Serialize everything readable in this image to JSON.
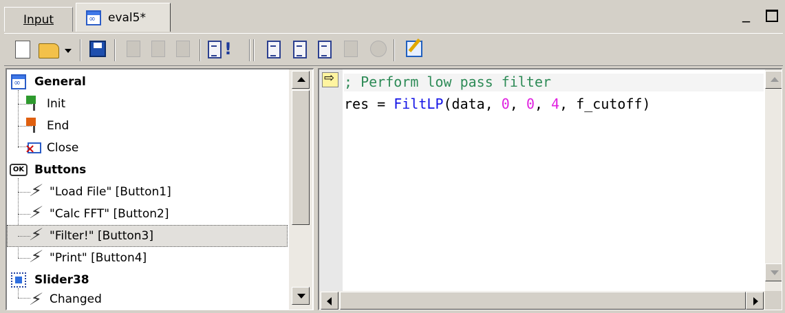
{
  "tabs": {
    "input": {
      "label": "Input"
    },
    "active": {
      "label": "eval5*"
    }
  },
  "window_controls": {
    "minimize": "_"
  },
  "toolbar": {
    "buttons": [
      "new-file",
      "open-file",
      "open-dropdown",
      "save",
      "cut",
      "copy",
      "paste",
      "run-script",
      "step-into",
      "step-over",
      "step-out",
      "toggle-breakpoint",
      "stop",
      "edit"
    ]
  },
  "tree": {
    "general": {
      "label": "General",
      "children": [
        "Init",
        "End",
        "Close"
      ]
    },
    "buttons": {
      "label": "Buttons",
      "icon_text": "OK",
      "children": [
        "\"Load File\" [Button1]",
        "\"Calc FFT\" [Button2]",
        "\"Filter!\" [Button3]",
        "\"Print\" [Button4]"
      ],
      "selected_index": 2
    },
    "slider": {
      "label": "Slider38",
      "children": [
        "Changed"
      ]
    }
  },
  "code": {
    "line1": "; Perform low pass filter",
    "line2": {
      "lhs": "res = ",
      "func": "FiltLP",
      "open": "(data, ",
      "a": "0",
      "sep1": ", ",
      "b": "0",
      "sep2": ", ",
      "c": "4",
      "rest": ", f_cutoff)"
    }
  },
  "colors": {
    "comment": "#2e8b57",
    "function": "#1414e6",
    "number": "#e020e0",
    "background": "#d4d0c8"
  }
}
